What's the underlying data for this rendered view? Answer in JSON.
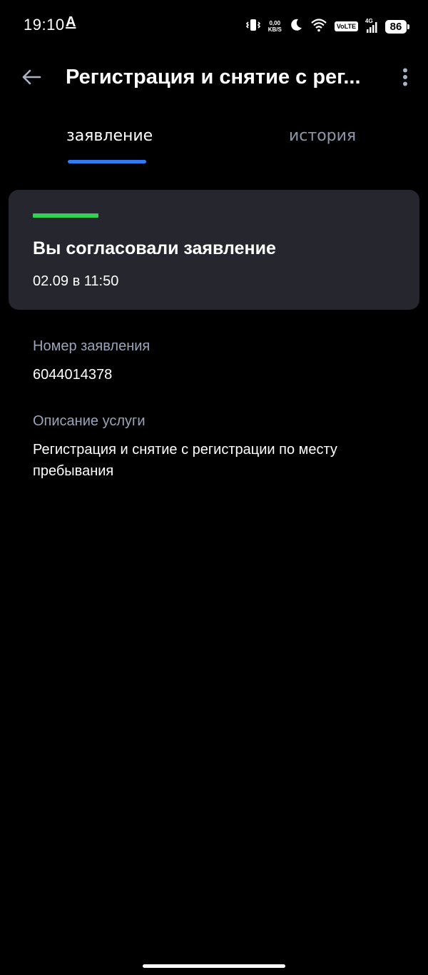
{
  "status_bar": {
    "time": "19:10",
    "a_indicator": "A",
    "net_speed_value": "0,00",
    "net_speed_unit": "KB/S",
    "volte": "VoLTE",
    "network": "4G",
    "battery": "86",
    "icons": [
      "vibrate-icon",
      "moon-icon",
      "wifi-icon",
      "signal-icon"
    ]
  },
  "app_bar": {
    "title": "Регистрация и снятие с рег..."
  },
  "tabs": [
    {
      "label": "заявление",
      "active": true
    },
    {
      "label": "история",
      "active": false
    }
  ],
  "status_card": {
    "title": "Вы согласовали заявление",
    "date": "02.09 в 11:50",
    "stripe_color": "#33d056"
  },
  "details": {
    "number_label": "Номер заявления",
    "number_value": "6044014378",
    "description_label": "Описание услуги",
    "description_value": "Регистрация и снятие с регистрации по месту пребывания"
  },
  "colors": {
    "background": "#000000",
    "card": "#26272e",
    "accent": "#2f7ef0",
    "muted": "#9aa4b8"
  }
}
